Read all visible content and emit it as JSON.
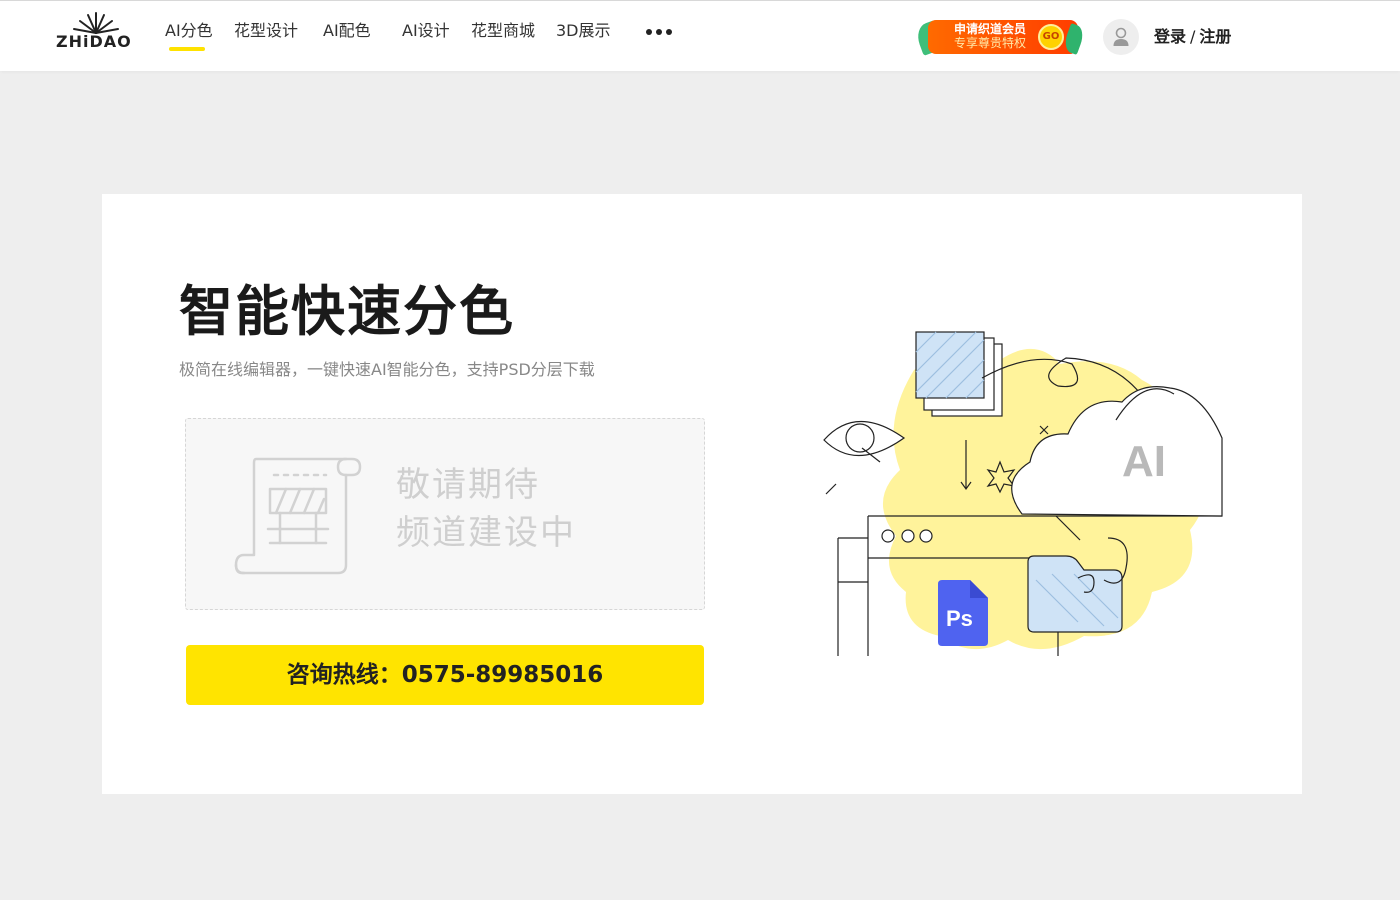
{
  "header": {
    "logo_text": "ZHiDAO",
    "nav": [
      {
        "label": "AI分色",
        "active": true
      },
      {
        "label": "花型设计"
      },
      {
        "label": "AI配色"
      },
      {
        "label": "AI设计"
      },
      {
        "label": "花型商城"
      },
      {
        "label": "3D展示"
      }
    ],
    "more_icon": "more-horizontal-icon",
    "vip": {
      "line1": "申请织道会员",
      "line2": "专享尊贵特权",
      "go": "GO"
    },
    "avatar_icon": "user-icon",
    "login_label": "登录",
    "separator": "/",
    "register_label": "注册"
  },
  "main": {
    "title": "智能快速分色",
    "subtitle": "极简在线编辑器，一键快速AI智能分色，支持PSD分层下载",
    "placeholder": {
      "icon": "under-construction-icon",
      "line1": "敬请期待",
      "line2": "频道建设中"
    },
    "hotline_label": "咨询热线：0575-89985016",
    "illustration": {
      "cloud_label": "AI",
      "ps_label": "Ps"
    }
  },
  "colors": {
    "accent_yellow": "#ffe400",
    "page_background": "#eeeeee",
    "vip_orange": "#ff5a00",
    "ps_blue": "#4f63f0",
    "blob_yellow": "#fff39b"
  }
}
